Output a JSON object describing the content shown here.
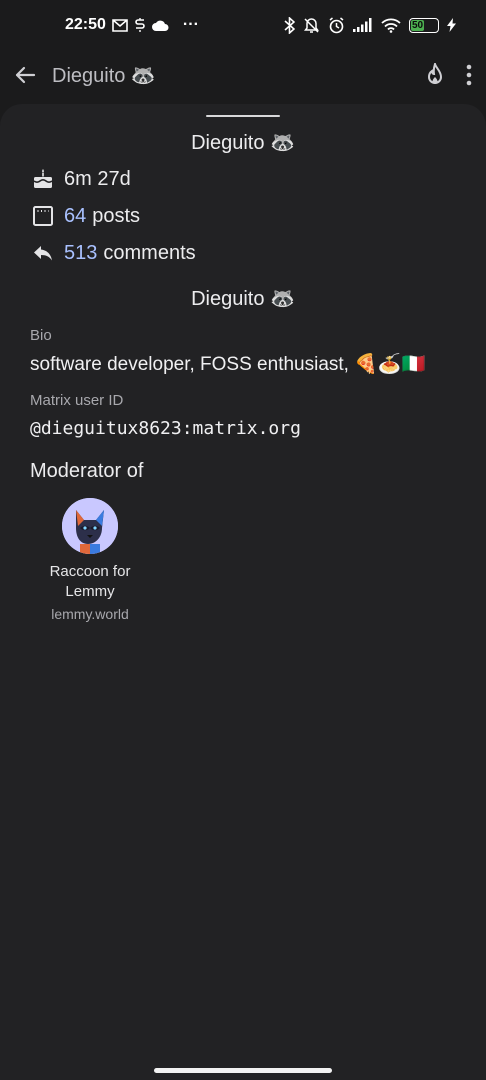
{
  "status_bar": {
    "time": "22:50",
    "more": "···",
    "battery_level": "50",
    "icons_left": [
      "gmail-icon",
      "s-icon",
      "cloud-icon"
    ],
    "icons_right": [
      "bluetooth-icon",
      "silent-icon",
      "alarm-icon",
      "signal-icon",
      "wifi-icon",
      "battery-icon",
      "charging-icon"
    ]
  },
  "app_bar": {
    "title": "Dieguito 🦝",
    "back_icon": "arrow-left-icon",
    "sort_icon": "flame-icon",
    "menu_icon": "more-vert-icon"
  },
  "profile": {
    "title": "Dieguito 🦝",
    "account_age": "6m 27d",
    "posts_count": "64",
    "posts_label": "posts",
    "comments_count": "513",
    "comments_label": "comments",
    "display_name": "Dieguito 🦝",
    "bio_label": "Bio",
    "bio": "software developer, FOSS enthusiast, 🍕🍝🇮🇹",
    "matrix_label": "Matrix user ID",
    "matrix_id": "@dieguitux8623:matrix.org",
    "moderator_heading": "Moderator of"
  },
  "moderated_communities": [
    {
      "name": "Raccoon for Lemmy",
      "instance": "lemmy.world"
    }
  ],
  "colors": {
    "background": "#1b1b1c",
    "sheet": "#222224",
    "accent": "#a9c1ff",
    "battery": "#4caf50"
  }
}
